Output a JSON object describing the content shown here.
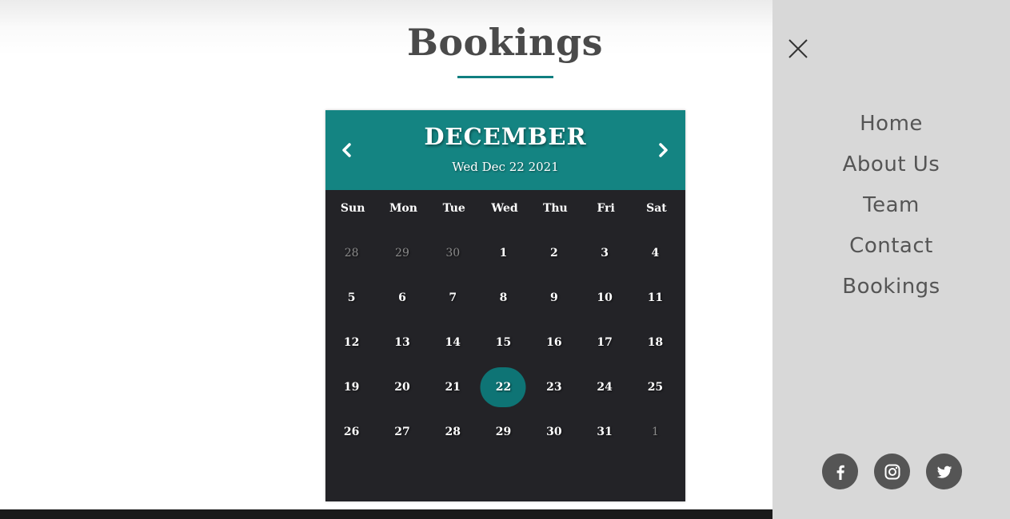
{
  "page": {
    "title": "Bookings"
  },
  "calendar": {
    "month": "DECEMBER",
    "current_date": "Wed Dec 22 2021",
    "weekdays": [
      "Sun",
      "Mon",
      "Tue",
      "Wed",
      "Thu",
      "Fri",
      "Sat"
    ],
    "weeks": [
      [
        "28",
        "29",
        "30",
        "1",
        "2",
        "3",
        "4"
      ],
      [
        "5",
        "6",
        "7",
        "8",
        "9",
        "10",
        "11"
      ],
      [
        "12",
        "13",
        "14",
        "15",
        "16",
        "17",
        "18"
      ],
      [
        "19",
        "20",
        "21",
        "22",
        "23",
        "24",
        "25"
      ],
      [
        "26",
        "27",
        "28",
        "29",
        "30",
        "31",
        "1"
      ]
    ],
    "selected_day": "22",
    "colors": {
      "header": "#148482",
      "body": "#232327",
      "selected": "#0e7475"
    }
  },
  "menu": {
    "items": [
      "Home",
      "About Us",
      "Team",
      "Contact",
      "Bookings"
    ],
    "close_icon": "close-icon",
    "socials": [
      "facebook-icon",
      "instagram-icon",
      "twitter-icon"
    ]
  }
}
